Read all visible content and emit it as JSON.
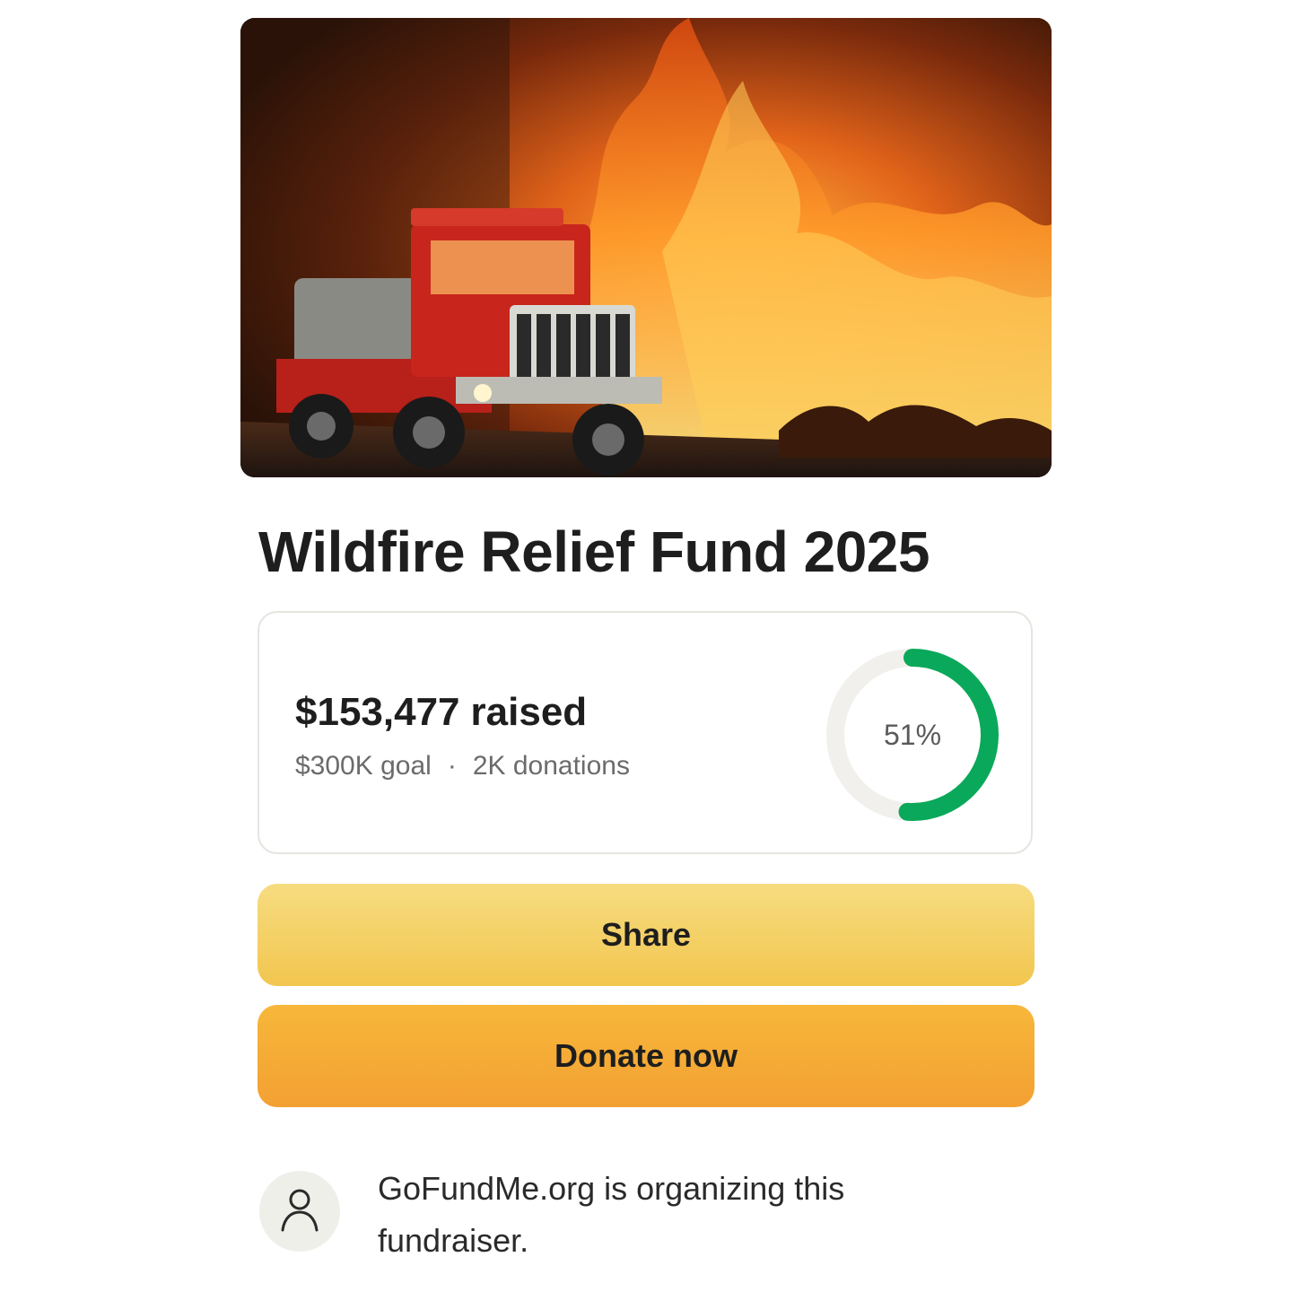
{
  "campaign": {
    "title": "Wildfire Relief Fund 2025",
    "hero_image": "fire-truck-wildfire-photo"
  },
  "progress": {
    "amount_raised": "$153,477",
    "raised_suffix": "raised",
    "goal": "$300K goal",
    "separator": "·",
    "donations": "2K donations",
    "percent_label": "51%",
    "percent_value": 0.51,
    "ring_color": "#0aa85a",
    "ring_track_color": "#f1f0ec"
  },
  "actions": {
    "share_label": "Share",
    "donate_label": "Donate now"
  },
  "organizer": {
    "avatar_icon": "user-icon",
    "text": "GoFundMe.org is organizing this fundraiser."
  }
}
